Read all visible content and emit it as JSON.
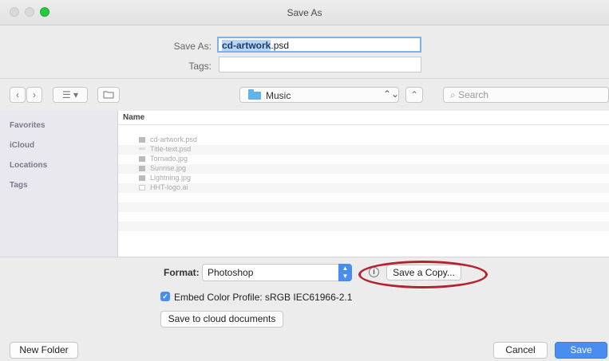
{
  "window": {
    "title": "Save As"
  },
  "form": {
    "save_as_label": "Save As:",
    "filename_selected": "cd-artwork",
    "filename_ext": ".psd",
    "tags_label": "Tags:",
    "tags_value": ""
  },
  "toolbar": {
    "back_glyph": "‹",
    "forward_glyph": "›",
    "view_glyph": "☰ ▾",
    "location": "Music",
    "search_placeholder": "Search"
  },
  "sidebar": {
    "items": [
      {
        "label": "Favorites"
      },
      {
        "label": "iCloud"
      },
      {
        "label": "Locations"
      },
      {
        "label": "Tags"
      }
    ]
  },
  "filelist": {
    "column_header": "Name",
    "files": [
      {
        "name": "cd-artwork.psd",
        "icon": "image-icon"
      },
      {
        "name": "Title-text.psd",
        "icon": "text-icon"
      },
      {
        "name": "Tornado.jpg",
        "icon": "image-icon"
      },
      {
        "name": "Sunrise.jpg",
        "icon": "image-icon"
      },
      {
        "name": "Lightning.jpg",
        "icon": "image-icon"
      },
      {
        "name": "HHT-logo.ai",
        "icon": "document-icon"
      }
    ]
  },
  "options": {
    "format_label": "Format:",
    "format_value": "Photoshop",
    "info_glyph": "i",
    "save_copy_label": "Save a Copy...",
    "embed_label": "Embed Color Profile:  sRGB IEC61966-2.1",
    "embed_checked": true,
    "cloud_label": "Save to cloud documents"
  },
  "footer": {
    "new_folder_label": "New Folder",
    "cancel_label": "Cancel",
    "save_label": "Save"
  },
  "colors": {
    "accent": "#4a8df0",
    "highlight_oval": "#b3232f",
    "sidebar_bg": "#e8e8ee"
  }
}
